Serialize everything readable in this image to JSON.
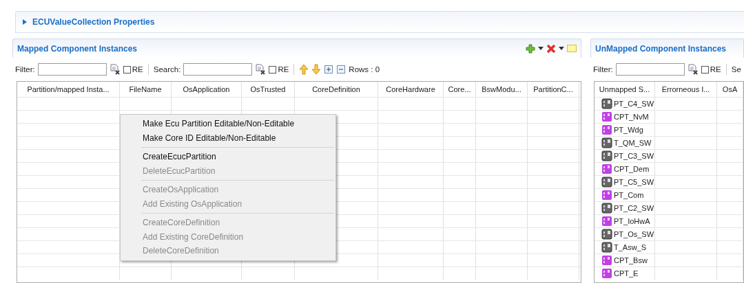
{
  "properties_section": {
    "title": "ECUValueCollection Properties",
    "expanded": false
  },
  "mapped_panel": {
    "title": "Mapped Component Instances",
    "filter_label": "Filter:",
    "filter_re": {
      "label": "RE",
      "checked": false
    },
    "search_label": "Search:",
    "search_re": {
      "label": "RE",
      "checked": false
    },
    "rows_count": "Rows : 0",
    "columns": [
      "Partition/mapped Insta...",
      "FileName",
      "OsApplication",
      "OsTrusted",
      "CoreDefinition",
      "CoreHardware",
      "Core...",
      "BswModu...",
      "PartitionC..."
    ]
  },
  "context_menu": {
    "groups": [
      [
        {
          "label": "Make Ecu Partition Editable/Non-Editable",
          "disabled": false
        },
        {
          "label": "Make Core ID Editable/Non-Editable",
          "disabled": false
        }
      ],
      [
        {
          "label": "CreateEcucPartition",
          "disabled": false
        },
        {
          "label": "DeleteEcucPartition",
          "disabled": true
        }
      ],
      [
        {
          "label": "CreateOsApplication",
          "disabled": true
        },
        {
          "label": "Add Existing OsApplication",
          "disabled": true
        }
      ],
      [
        {
          "label": "CreateCoreDefinition",
          "disabled": true
        },
        {
          "label": "Add Existing CoreDefinition",
          "disabled": true
        },
        {
          "label": "DeleteCoreDefinition",
          "disabled": true
        }
      ]
    ]
  },
  "unmapped_panel": {
    "title": "UnMapped Component Instances",
    "filter_label": "Filter:",
    "filter_re": {
      "label": "RE",
      "checked": false
    },
    "search_label": "Se",
    "columns": [
      "Unmapped S...",
      "Errorneous I...",
      "OsA"
    ],
    "rows": [
      {
        "name": "PT_C4_SW",
        "kind": "application"
      },
      {
        "name": "CPT_NvM",
        "kind": "service"
      },
      {
        "name": "PT_Wdg",
        "kind": "service"
      },
      {
        "name": "T_QM_SW",
        "kind": "application"
      },
      {
        "name": "PT_C3_SW",
        "kind": "application"
      },
      {
        "name": "CPT_Dem",
        "kind": "service"
      },
      {
        "name": "PT_C5_SW",
        "kind": "application"
      },
      {
        "name": "PT_Com",
        "kind": "service"
      },
      {
        "name": "PT_C2_SW",
        "kind": "application"
      },
      {
        "name": "PT_IoHwA",
        "kind": "service"
      },
      {
        "name": "PT_Os_SW",
        "kind": "application"
      },
      {
        "name": "T_Asw_S",
        "kind": "application"
      },
      {
        "name": "CPT_Bsw",
        "kind": "service"
      },
      {
        "name": "CPT_E",
        "kind": "service"
      }
    ]
  }
}
